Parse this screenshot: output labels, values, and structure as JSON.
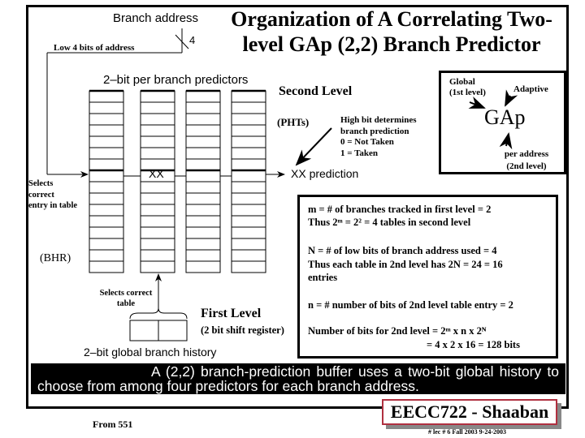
{
  "slide": {
    "title": "Organization of A Correlating Two-level GAp (2,2) Branch Predictor",
    "title_line1": "Organization of A Correlating Two-",
    "title_line2": "level GAp (2,2) Branch Predictor"
  },
  "diagram": {
    "branch_address_label": "Branch address",
    "bus_width_label": "4",
    "low_bits_label": "Low 4 bits of address",
    "pht_header": "2–bit per branch predictors",
    "second_level_label": "Second Level",
    "phts_label": "(PHTs)",
    "high_bit_note": [
      "High bit determines",
      "branch prediction",
      "0  =  Not Taken",
      "1 =  Taken"
    ],
    "selected_entry_value": "XX",
    "prediction_output": "XX prediction",
    "selects_entry_note": [
      "Selects",
      "correct",
      "entry in table"
    ],
    "bhr_label": "(BHR)",
    "selects_table_note": [
      "Selects correct",
      "table"
    ],
    "first_level_label": "First Level",
    "shift_register_label": "(2 bit shift register)",
    "global_history_label": "2–bit global branch history",
    "table_count": 4,
    "rows_per_table": 16,
    "selected_table_index": 1
  },
  "gap_box": {
    "global_label": [
      "Global",
      "(1st level)"
    ],
    "adaptive_label": "Adaptive",
    "acronym": "GAp",
    "per_address_label": [
      "per address",
      "(2nd level)"
    ]
  },
  "info_box": {
    "m_line": "m =  # of  branches tracked  in first level  = 2",
    "m_thus_line": "Thus  2ᵐ  =  2² = 4   tables in second level",
    "n_upper_line": "N = # of low bits of branch address used  = 4",
    "n_upper_thus_line": "Thus each table in 2nd level  has  2N  = 24 = 16",
    "n_upper_entries": "entries",
    "n_lower_line": "n =  #  number of bits of 2nd level table entry = 2",
    "bits_line": "Number of bits for 2nd level = 2ᵐ x  n x 2ᴺ",
    "bits_result_line": "=  4  x  2 x  16 = 128 bits"
  },
  "caption": {
    "line1": "A (2,2) branch-prediction buffer uses a two-bit global history to",
    "line2": "choose from among four predictors for each branch address."
  },
  "footer": {
    "source": "From 551",
    "badge": "EECC722 - Shaaban",
    "meta": "#  lec # 6   Fall 2003   9-24-2003",
    "badge_border_color": "#b03040"
  }
}
